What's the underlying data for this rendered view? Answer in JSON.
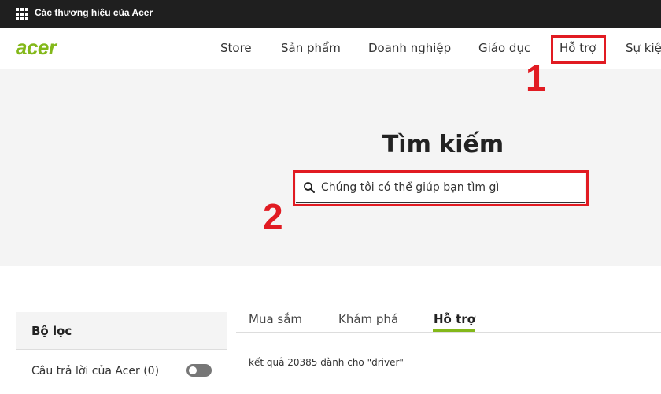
{
  "topbar": {
    "title": "Các thương hiệu của Acer",
    "icon": "grid-icon"
  },
  "navbar": {
    "logo": "acer",
    "items": [
      "Store",
      "Sản phẩm",
      "Doanh nghiệp",
      "Giáo dục",
      "Hỗ trợ",
      "Sự kiệ"
    ]
  },
  "annotations": {
    "marker1": "1",
    "marker2": "2",
    "color": "#e11b22"
  },
  "hero": {
    "title": "Tìm kiếm",
    "search_placeholder": "Chúng tôi có thể giúp bạn tìm gì"
  },
  "filters": {
    "title": "Bộ lọc",
    "toggle_label": "Câu trả lời của Acer (0)",
    "toggle_on": false
  },
  "tabs": {
    "items": [
      "Mua sắm",
      "Khám phá",
      "Hỗ trợ"
    ],
    "active": "Hỗ trợ",
    "accent": "#83b81a"
  },
  "results_text": "kết quả 20385 dành cho \"driver\""
}
